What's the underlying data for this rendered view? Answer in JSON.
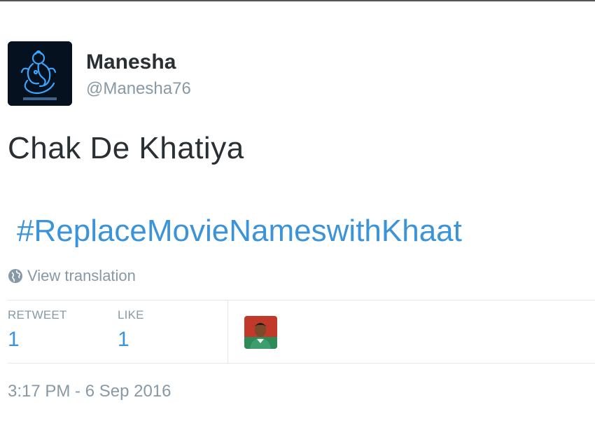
{
  "tweet": {
    "author": {
      "name": "Manesha",
      "handle": "@Manesha76",
      "avatar_icon": "ganesha-neon-avatar"
    },
    "text": "Chak De Khatiya",
    "hashtag": "#ReplaceMovieNameswithKhaat",
    "view_translation": "View translation",
    "stats": {
      "retweet_label": "RETWEET",
      "retweet_count": "1",
      "like_label": "LIKE",
      "like_count": "1"
    },
    "liker_avatar_icon": "user-photo-avatar",
    "timestamp": "3:17 PM - 6 Sep 2016"
  },
  "colors": {
    "text": "#292f33",
    "muted": "#8899a6",
    "link": "#3b94d9",
    "divider": "#e1e8ed"
  }
}
